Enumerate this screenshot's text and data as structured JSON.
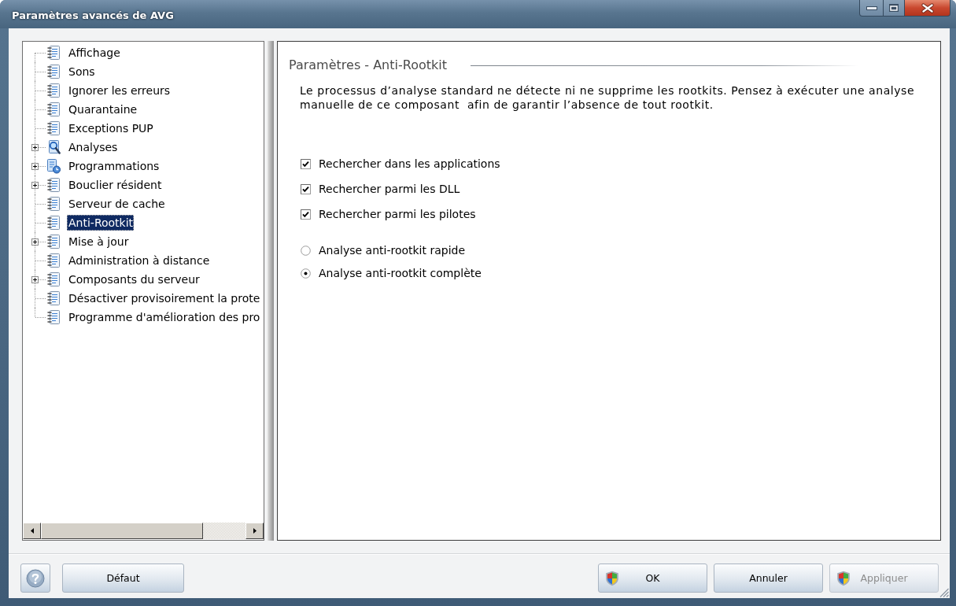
{
  "window": {
    "title": "Paramètres avancés de AVG"
  },
  "tree": {
    "items": [
      {
        "label": "Affichage",
        "kind": "notebook",
        "expandable": false,
        "selected": false
      },
      {
        "label": "Sons",
        "kind": "notebook",
        "expandable": false,
        "selected": false
      },
      {
        "label": "Ignorer les erreurs",
        "kind": "notebook",
        "expandable": false,
        "selected": false
      },
      {
        "label": "Quarantaine",
        "kind": "notebook",
        "expandable": false,
        "selected": false
      },
      {
        "label": "Exceptions PUP",
        "kind": "notebook",
        "expandable": false,
        "selected": false
      },
      {
        "label": "Analyses",
        "kind": "magnifier",
        "expandable": true,
        "selected": false
      },
      {
        "label": "Programmations",
        "kind": "schedule",
        "expandable": true,
        "selected": false
      },
      {
        "label": "Bouclier résident",
        "kind": "notebook",
        "expandable": true,
        "selected": false
      },
      {
        "label": "Serveur de cache",
        "kind": "notebook",
        "expandable": false,
        "selected": false
      },
      {
        "label": "Anti-Rootkit",
        "kind": "notebook",
        "expandable": false,
        "selected": true
      },
      {
        "label": "Mise à jour",
        "kind": "notebook",
        "expandable": true,
        "selected": false
      },
      {
        "label": "Administration à distance",
        "kind": "notebook",
        "expandable": false,
        "selected": false
      },
      {
        "label": "Composants du serveur",
        "kind": "notebook",
        "expandable": true,
        "selected": false
      },
      {
        "label": "Désactiver provisoirement la prote",
        "kind": "notebook",
        "expandable": false,
        "selected": false
      },
      {
        "label": "Programme d'amélioration des pro",
        "kind": "notebook",
        "expandable": false,
        "selected": false
      }
    ]
  },
  "panel": {
    "heading": "Paramètres - Anti-Rootkit",
    "description": "Le processus d’analyse standard ne détecte ni ne supprime les rootkits. Pensez à exécuter une analyse manuelle de ce composant  afin de garantir l’absence de tout rootkit.",
    "options": [
      {
        "kind": "checkbox",
        "label": "Rechercher dans les applications",
        "checked": true
      },
      {
        "kind": "checkbox",
        "label": "Rechercher parmi les DLL",
        "checked": true
      },
      {
        "kind": "checkbox",
        "label": "Rechercher parmi les pilotes",
        "checked": true
      },
      {
        "kind": "radio",
        "label": "Analyse anti-rootkit rapide",
        "selected": false
      },
      {
        "kind": "radio",
        "label": "Analyse anti-rootkit complète",
        "selected": true
      }
    ]
  },
  "footer": {
    "left_buttons": [
      {
        "label": "Défaut",
        "shield": false,
        "disabled": false
      }
    ],
    "right_buttons": [
      {
        "label": "OK",
        "shield": true,
        "disabled": false
      },
      {
        "label": "Annuler",
        "shield": false,
        "disabled": false
      },
      {
        "label": "Appliquer",
        "shield": true,
        "disabled": true
      }
    ]
  }
}
